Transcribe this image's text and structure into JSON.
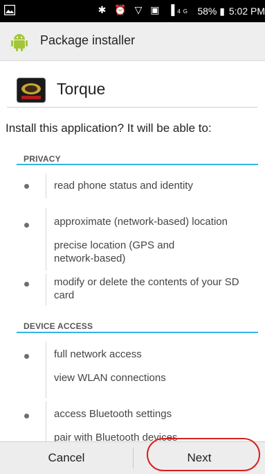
{
  "status_bar": {
    "battery": "58%",
    "time": "5:02 PM",
    "network_badge": "4G"
  },
  "action_bar": {
    "title": "Package installer",
    "icon": "android-icon"
  },
  "app": {
    "name": "Torque",
    "icon": "torque-app-icon"
  },
  "question": "Install this application? It will be able to:",
  "sections": {
    "privacy": {
      "title": "PRIVACY",
      "items": [
        "read phone status and identity",
        "approximate (network-based) location",
        "precise location (GPS and network-based)",
        "modify or delete the contents of your SD card"
      ]
    },
    "device_access": {
      "title": "DEVICE ACCESS",
      "items": [
        "full network access",
        "view WLAN connections",
        "access Bluetooth settings",
        "pair with Bluetooth devices"
      ]
    }
  },
  "buttons": {
    "cancel": "Cancel",
    "next": "Next"
  },
  "colors": {
    "accent": "#33b5e5",
    "highlight": "#d62020"
  }
}
